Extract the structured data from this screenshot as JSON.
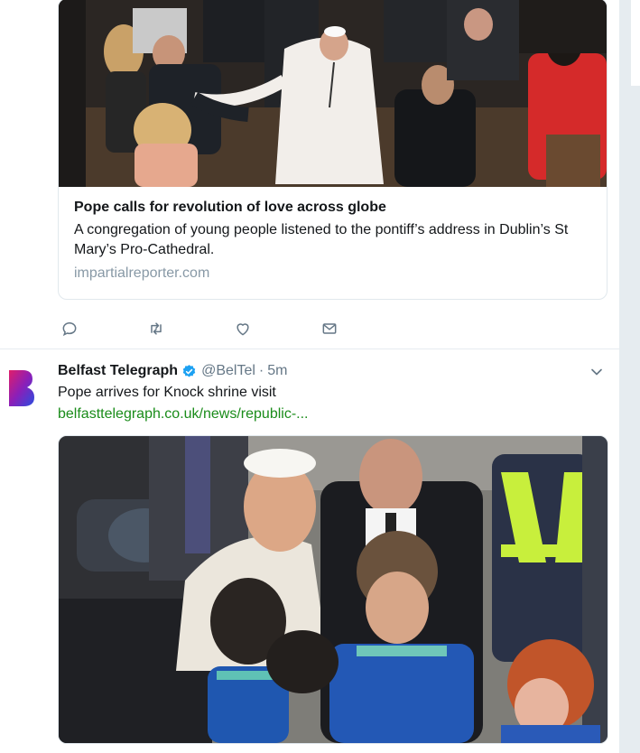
{
  "card": {
    "title": "Pope calls for revolution of love across globe",
    "description": "A congregation of young people listened to the pontiff’s address in Dublin’s St Mary’s Pro-Cathedral.",
    "domain": "impartialreporter.com",
    "image_alt": "pope-greeting-crowd-photo"
  },
  "actions": {
    "reply_icon": "reply-icon",
    "retweet_icon": "retweet-icon",
    "like_icon": "heart-icon",
    "dm_icon": "envelope-icon"
  },
  "tweet": {
    "author": "Belfast Telegraph",
    "handle": "@BelTel",
    "separator": "·",
    "time": "5m",
    "text": "Pope arrives for Knock shrine visit",
    "link": "belfasttelegraph.co.uk/news/republic-...",
    "photo_alt": "pope-with-children-photo"
  },
  "colors": {
    "link_green": "#1a8c1a",
    "verified_blue": "#1da1f2",
    "muted": "#657786",
    "border": "#e6ecf0"
  }
}
